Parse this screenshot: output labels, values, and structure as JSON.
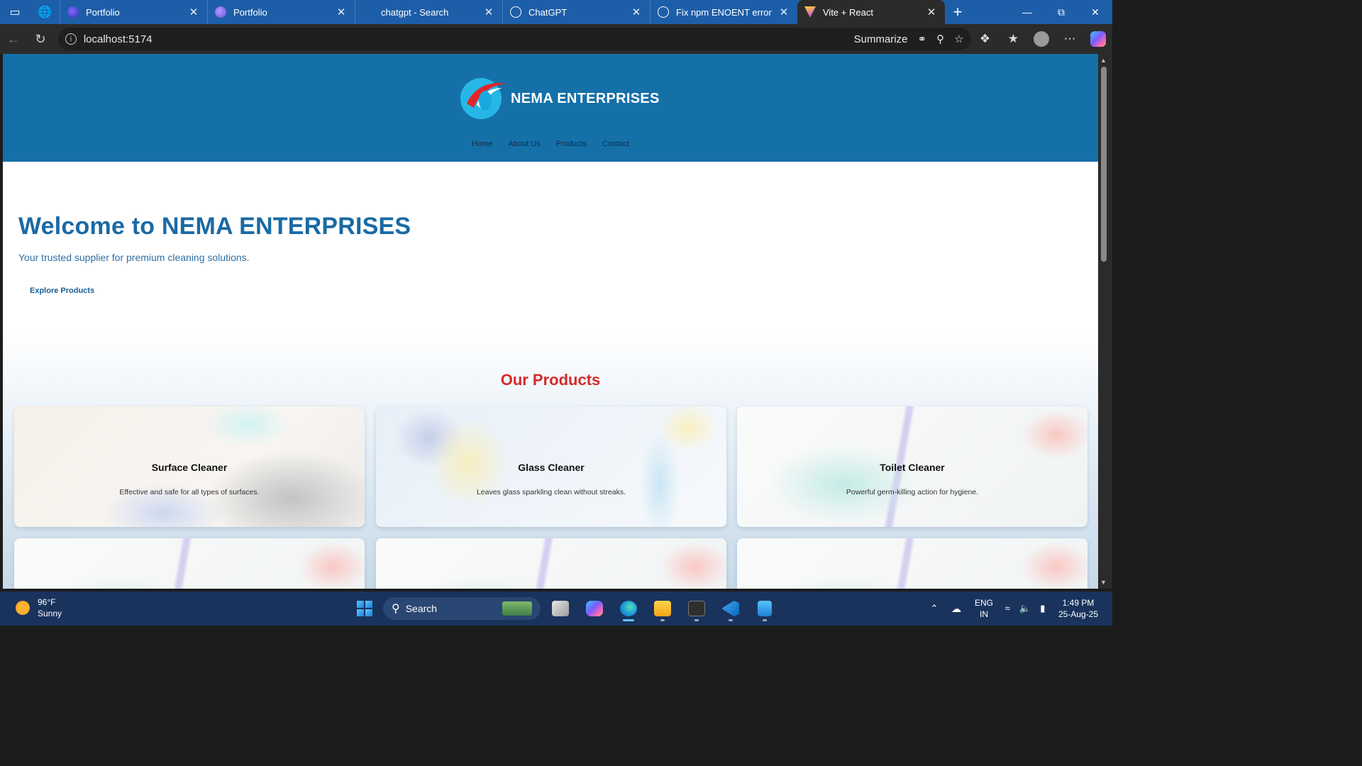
{
  "browser": {
    "tabs": [
      {
        "title": "Portfolio",
        "favicon": "portfolio-favicon",
        "active": false
      },
      {
        "title": "Portfolio",
        "favicon": "portfolio-favicon",
        "active": false
      },
      {
        "title": "chatgpt - Search",
        "favicon": "search-favicon",
        "active": false
      },
      {
        "title": "ChatGPT",
        "favicon": "chatgpt-favicon",
        "active": false
      },
      {
        "title": "Fix npm ENOENT error",
        "favicon": "chatgpt-favicon",
        "active": false
      },
      {
        "title": "Vite + React",
        "favicon": "vite-favicon",
        "active": true
      }
    ],
    "url": "localhost:5174",
    "summarize_label": "Summarize",
    "colors": {
      "titlebar": "#1d5ea8",
      "toolbar": "#2b2b2b"
    }
  },
  "site": {
    "brand_name": "NEMA ENTERPRISES",
    "nav": [
      "Home",
      "About Us",
      "Products",
      "Contact"
    ],
    "hero": {
      "title": "Welcome to NEMA ENTERPRISES",
      "subtitle": "Your trusted supplier for premium cleaning solutions.",
      "cta": "Explore Products"
    },
    "products_title": "Our Products",
    "products": [
      {
        "name": "Surface Cleaner",
        "description": "Effective and safe for all types of surfaces."
      },
      {
        "name": "Glass Cleaner",
        "description": "Leaves glass sparkling clean without streaks."
      },
      {
        "name": "Toilet Cleaner",
        "description": "Powerful germ-killing action for hygiene."
      },
      {
        "name": "",
        "description": ""
      },
      {
        "name": "",
        "description": ""
      },
      {
        "name": "",
        "description": ""
      }
    ],
    "colors": {
      "header": "#1570a8",
      "hero_title": "#1a6aa4",
      "products_title": "#d42a2a"
    }
  },
  "taskbar": {
    "weather": {
      "temp": "96°F",
      "condition": "Sunny"
    },
    "search_placeholder": "Search",
    "apps": [
      "task-view-icon",
      "copilot-icon",
      "edge-icon",
      "file-explorer-icon",
      "terminal-icon",
      "vscode-icon",
      "notepad-icon"
    ],
    "language": {
      "line1": "ENG",
      "line2": "IN"
    },
    "time": "1:49 PM",
    "date": "25-Aug-25"
  }
}
